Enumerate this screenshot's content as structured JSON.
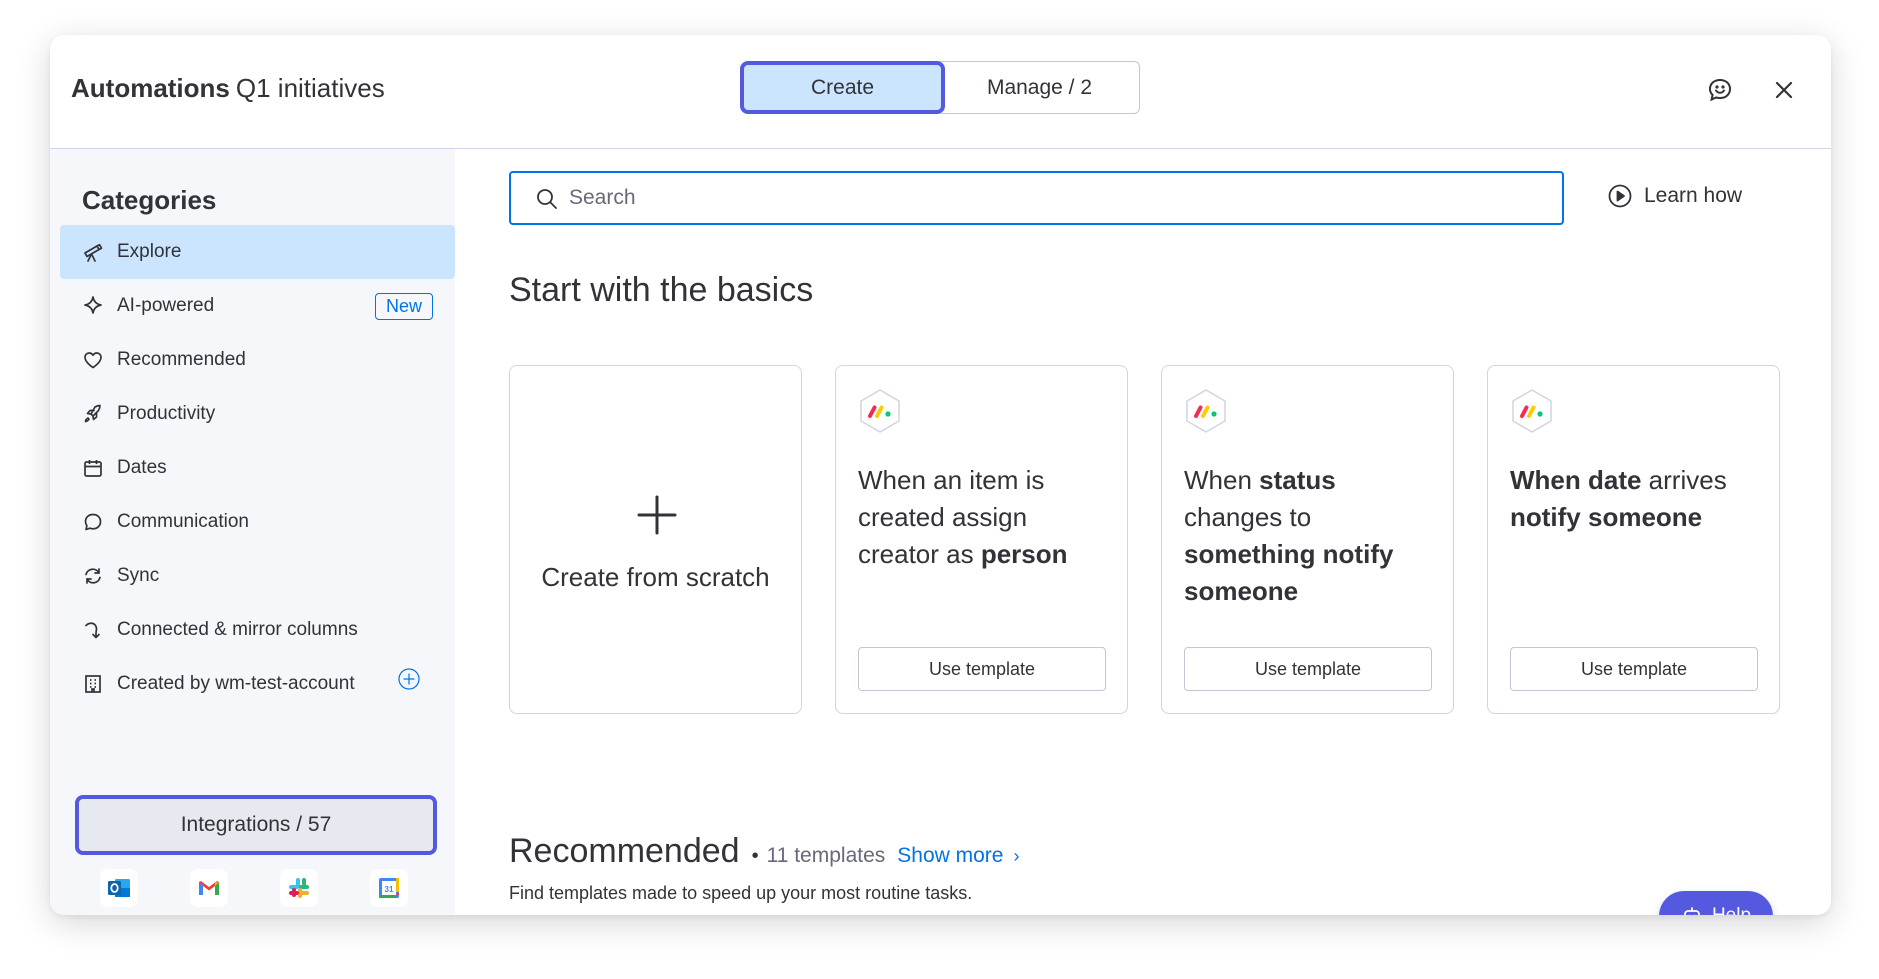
{
  "header": {
    "title_bold": "Automations",
    "title_board": "Q1 initiatives",
    "tab_create": "Create",
    "tab_manage": "Manage / 2",
    "feedback_icon": "feedback-icon",
    "close_icon": "close-icon"
  },
  "sidebar": {
    "title": "Categories",
    "items": [
      {
        "label": "Explore",
        "icon": "telescope-icon",
        "active": true
      },
      {
        "label": "AI-powered",
        "icon": "sparkle-icon",
        "badge": "New"
      },
      {
        "label": "Recommended",
        "icon": "heart-icon"
      },
      {
        "label": "Productivity",
        "icon": "rocket-icon"
      },
      {
        "label": "Dates",
        "icon": "calendar-icon"
      },
      {
        "label": "Communication",
        "icon": "chat-bubble-icon"
      },
      {
        "label": "Sync",
        "icon": "sync-icon"
      },
      {
        "label": "Connected & mirror columns",
        "icon": "connect-icon"
      },
      {
        "label": "Created by wm-test-account",
        "icon": "building-icon"
      }
    ],
    "integrations_label": "Integrations / 57",
    "integration_icons": [
      "outlook-icon",
      "gmail-icon",
      "slack-icon",
      "google-calendar-icon"
    ]
  },
  "main": {
    "search_placeholder": "Search",
    "search_value": "",
    "learn_how": "Learn how",
    "basics_title": "Start with the basics",
    "create_scratch": "Create from scratch",
    "use_template": "Use template",
    "recommended_title": "Recommended",
    "recommended_dot": "•",
    "recommended_count": "11 templates",
    "show_more": "Show more",
    "recommended_sub": "Find templates made to speed up your most routine tasks.",
    "help": "Help"
  },
  "colors": {
    "primary": "#0073ea",
    "accent_outline": "#5559df",
    "selected_bg": "#cce5ff",
    "sidebar_bg": "#f6f7fb"
  }
}
